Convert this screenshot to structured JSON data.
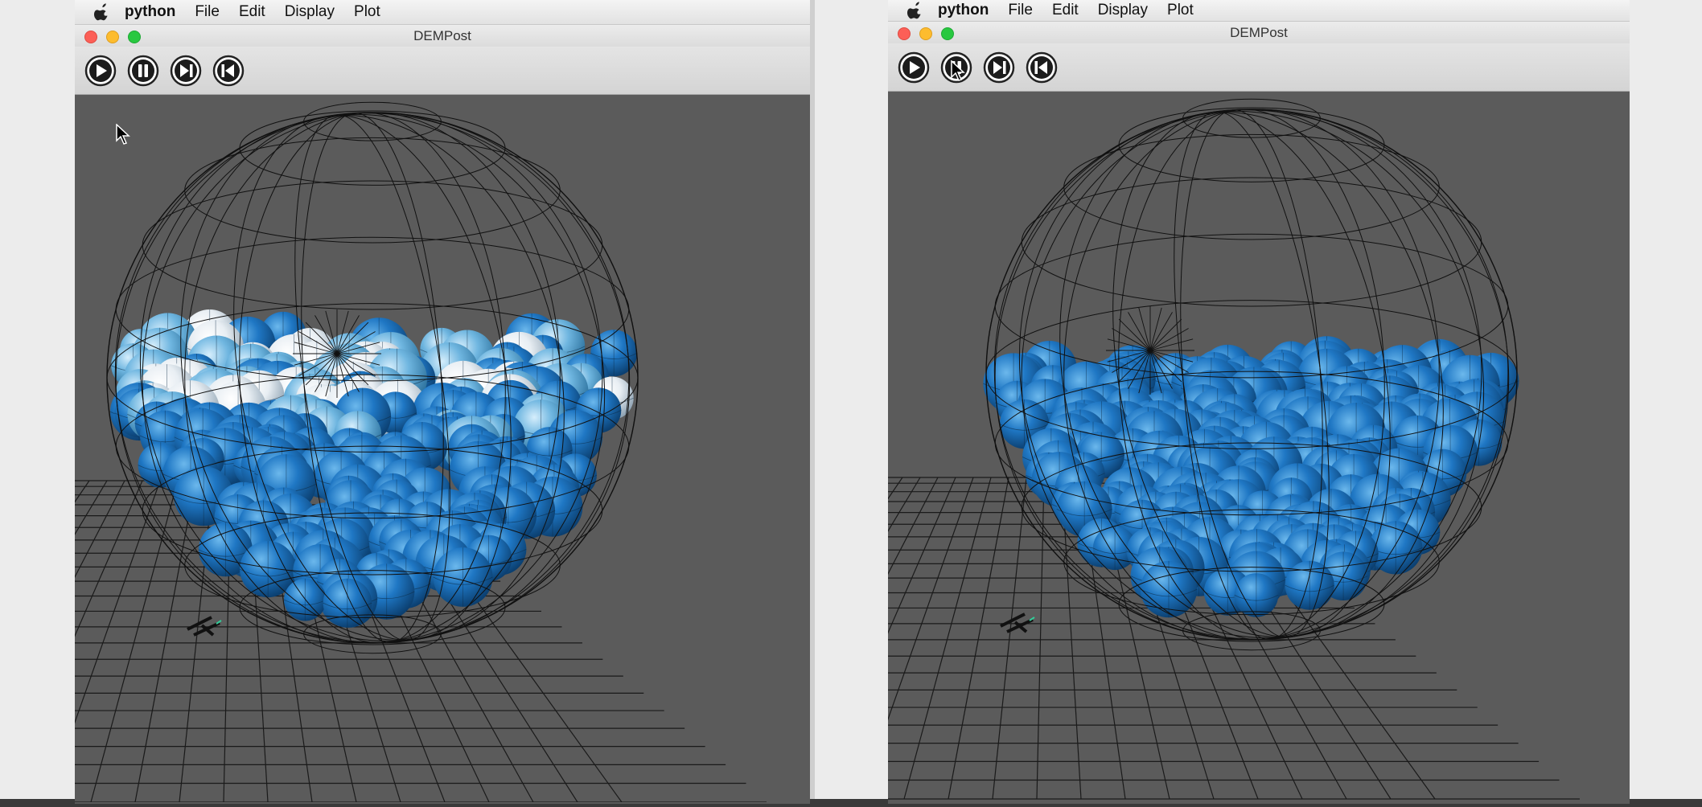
{
  "left": {
    "menubar": {
      "app": "python",
      "file": "File",
      "edit": "Edit",
      "display": "Display",
      "plot": "Plot"
    },
    "window": {
      "title": "DEMPost"
    },
    "toolbar": {
      "buttons": [
        "play",
        "pause",
        "step-forward",
        "step-back"
      ]
    }
  },
  "right": {
    "menubar": {
      "app": "python",
      "file": "File",
      "edit": "Edit",
      "display": "Display",
      "plot": "Plot"
    },
    "window": {
      "title": "DEMPost"
    },
    "toolbar": {
      "buttons": [
        "play",
        "pause",
        "step-forward",
        "step-back"
      ]
    }
  },
  "colors": {
    "viewport_bg": "#5b5b5b",
    "particle_blue": "#1f77c4",
    "particle_light": "#6fb6e0",
    "particle_white": "#e8eef3",
    "wireframe": "#111111"
  }
}
